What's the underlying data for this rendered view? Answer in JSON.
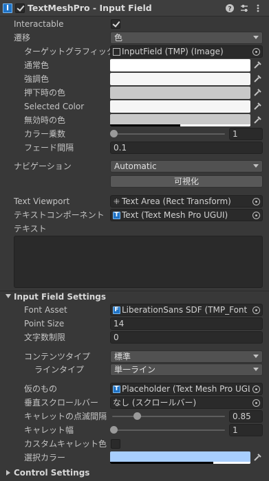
{
  "component": {
    "title": "TextMeshPro - Input Field",
    "icons": [
      "help-icon",
      "presets-icon",
      "more-icon"
    ]
  },
  "interactable": {
    "label": "Interactable",
    "checked": true
  },
  "transition": {
    "label": "遷移",
    "value": "色"
  },
  "target_graphic": {
    "label": "ターゲットグラフィックス",
    "value": "InputField (TMP) (Image)"
  },
  "colors": {
    "normal": {
      "label": "通常色",
      "hex": "#ffffff"
    },
    "highlighted": {
      "label": "強調色",
      "hex": "#f5f5f5"
    },
    "pressed": {
      "label": "押下時の色",
      "hex": "#c8c8c8"
    },
    "selected": {
      "label": "Selected Color",
      "hex": "#f5f5f5"
    },
    "disabled": {
      "label": "無効時の色",
      "hex": "#c8c8c8",
      "alpha": 0.5
    }
  },
  "color_multiplier": {
    "label": "カラー乗数",
    "value": "1",
    "fraction": 0.0
  },
  "fade_duration": {
    "label": "フェード間隔",
    "value": "0.1"
  },
  "navigation": {
    "label": "ナビゲーション",
    "value": "Automatic",
    "visualize_label": "可視化"
  },
  "text_viewport": {
    "label": "Text Viewport",
    "value": "Text Area (Rect Transform)"
  },
  "text_component": {
    "label": "テキストコンポーネント",
    "value": "Text (Text Mesh Pro UGUI)"
  },
  "text": {
    "label": "テキスト",
    "value": ""
  },
  "settings": {
    "title": "Input Field Settings",
    "font_asset": {
      "label": "Font Asset",
      "value": "LiberationSans SDF (TMP_Font A"
    },
    "point_size": {
      "label": "Point Size",
      "value": "14"
    },
    "char_limit": {
      "label": "文字数制限",
      "value": "0"
    },
    "content_type": {
      "label": "コンテンツタイプ",
      "value": "標準"
    },
    "line_type": {
      "label": "ラインタイプ",
      "value": "単一ライン"
    },
    "placeholder": {
      "label": "仮のもの",
      "value": "Placeholder (Text Mesh Pro UGL"
    },
    "vertical_scrollbar": {
      "label": "垂直スクロールバー",
      "value": "なし (スクロールバー)"
    },
    "caret_blink": {
      "label": "キャレットの点滅間隔",
      "value": "0.85",
      "fraction": 0.2125
    },
    "caret_width": {
      "label": "キャレット幅",
      "value": "1",
      "fraction": 0.0
    },
    "custom_caret_color": {
      "label": "カスタムキャレット色",
      "checked": false
    },
    "selection_color": {
      "label": "選択カラー",
      "hex": "#a8cefd"
    }
  },
  "control_settings": {
    "title": "Control Settings"
  }
}
